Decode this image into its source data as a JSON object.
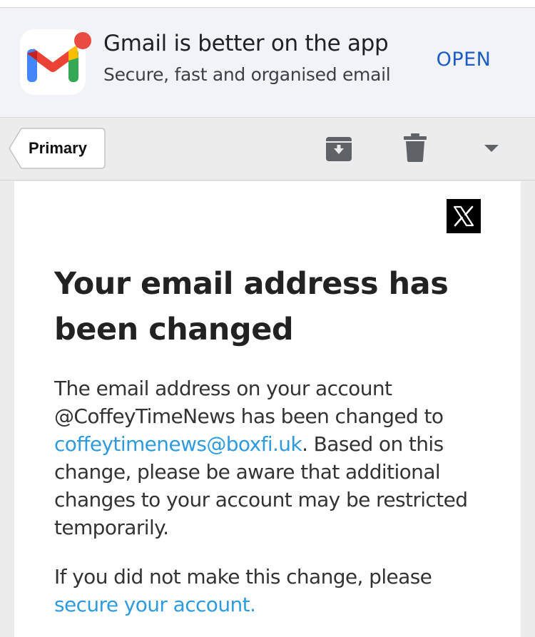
{
  "app_banner": {
    "title": "Gmail is better on the app",
    "subtitle": "Secure, fast and organised email",
    "open_label": "OPEN",
    "icon": "gmail-logo",
    "notification_dot_color": "#e94b43"
  },
  "toolbar": {
    "label_tag": "Primary",
    "actions": [
      "archive-icon",
      "delete-icon",
      "more-dropdown-icon"
    ]
  },
  "email": {
    "sender_logo": "x-logo",
    "heading": "Your email address has been changed",
    "paragraph1": {
      "part1": "The email address on your account @CoffeyTimeNews has been changed to ",
      "link": "coffeytimenews@boxfi.uk",
      "part2": ". Based on this change, please be aware that additional changes to your account may be restricted temporarily."
    },
    "paragraph2": {
      "part1": "If you did not make this change, please ",
      "link": "secure your account."
    }
  },
  "colors": {
    "link": "#2e9be0",
    "open_button": "#1a5dc4",
    "banner_background": "#f1f3f8"
  }
}
